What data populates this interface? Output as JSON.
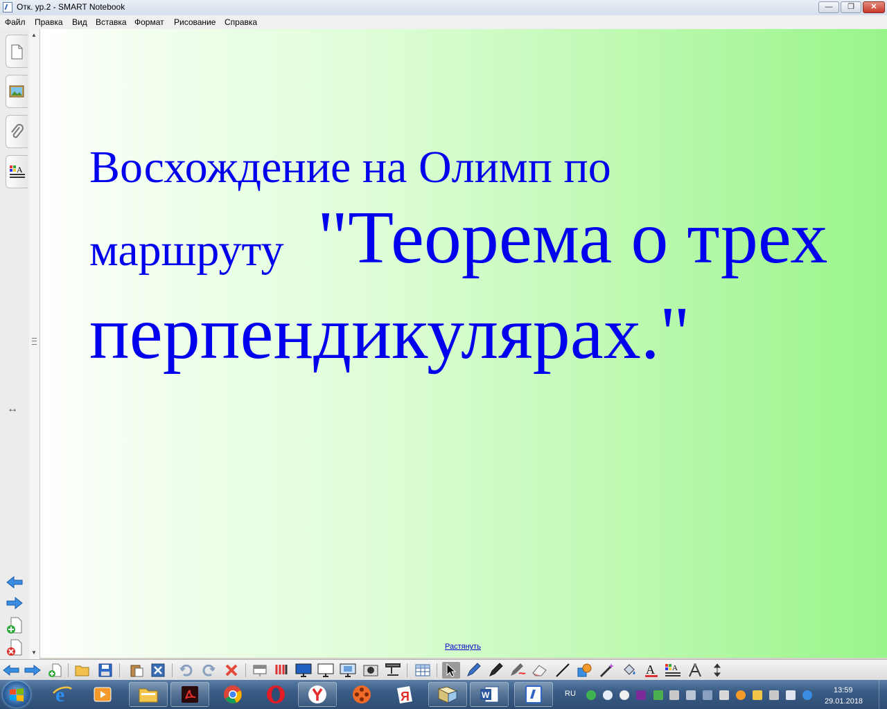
{
  "window": {
    "title": "Отк. ур.2 - SMART Notebook"
  },
  "menu": {
    "items": [
      "Файл",
      "Правка",
      "Вид",
      "Вставка",
      "Формат",
      "Рисование",
      "Справка"
    ]
  },
  "side_tabs": [
    "page-sorter-icon",
    "gallery-icon",
    "attachments-icon",
    "properties-icon"
  ],
  "slide": {
    "line1": "Восхождение на  Олимп по",
    "line2_small": "маршруту ",
    "line2_big": "\"Теорема о трех",
    "line3": "перпендикулярах.\"",
    "text_color": "#0000ee",
    "stretch_link": "Растянуть"
  },
  "toolbar": {
    "icons": [
      "previous-page-icon",
      "next-page-icon",
      "add-page-icon",
      "open-icon",
      "save-icon",
      "paste-icon",
      "full-screen-icon",
      "undo-icon",
      "redo-icon",
      "delete-icon",
      "screen-shade-icon",
      "pen-tray-icon",
      "display-icon",
      "blank-screen-icon",
      "capture-icon",
      "camera-icon",
      "document-camera-icon",
      "table-icon",
      "select-icon",
      "pen-icon",
      "creative-pen-icon",
      "magic-pen-icon",
      "eraser-icon",
      "line-icon",
      "shapes-icon",
      "magic-wand-icon",
      "fill-icon",
      "text-icon",
      "properties-icon",
      "measure-icon",
      "move-toolbar-icon"
    ]
  },
  "taskbar": {
    "apps": [
      "internet-explorer-icon",
      "media-player-icon",
      "file-explorer-icon",
      "acrobat-icon",
      "chrome-icon",
      "opera-icon",
      "yandex-browser-icon",
      "media-center-icon",
      "yandex-icon",
      "notebook-app-icon",
      "word-icon",
      "smart-notebook-icon"
    ],
    "language": "RU",
    "time": "13:59",
    "date": "29.01.2018"
  },
  "colors": {
    "accent_blue": "#0000ee",
    "canvas_green": "#98f58a"
  }
}
